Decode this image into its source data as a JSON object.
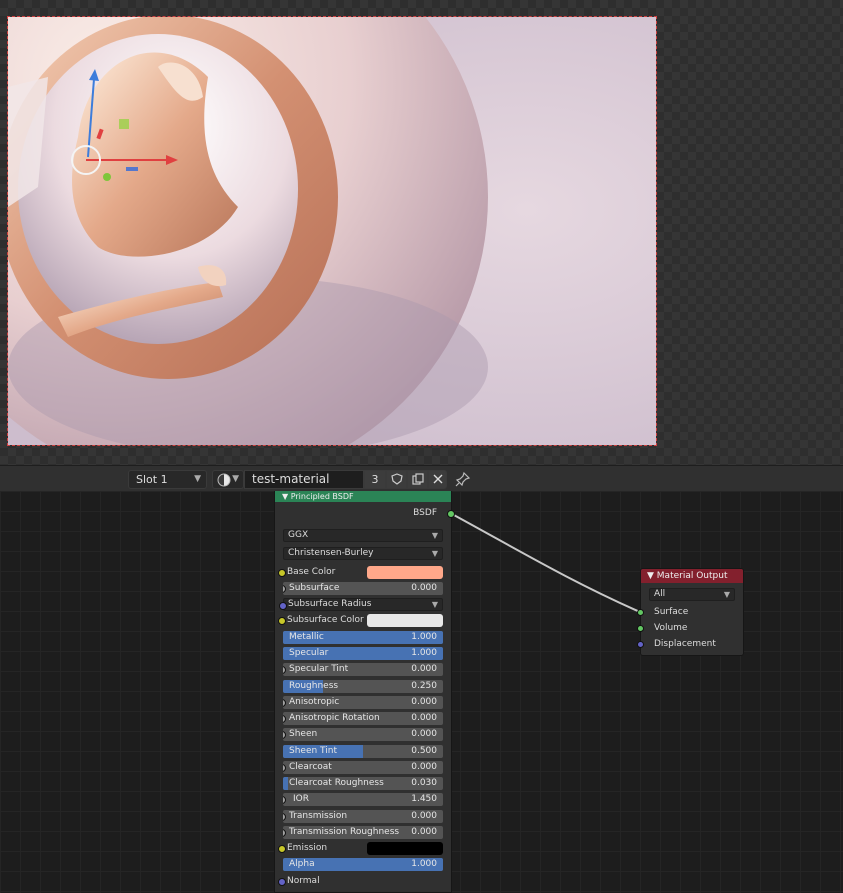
{
  "header": {
    "slot_label": "Slot 1",
    "material_name": "test-material",
    "user_count": "3"
  },
  "bsdf": {
    "title": "Principled BSDF",
    "output_label": "BSDF",
    "distribution": "GGX",
    "subsurface_method": "Christensen-Burley",
    "base_color_label": "Base Color",
    "base_color": "#ffa88a",
    "subsurface": {
      "label": "Subsurface",
      "value": "0.000",
      "fraction": 0
    },
    "subsurface_radius_label": "Subsurface Radius",
    "subsurface_color_label": "Subsurface Color",
    "subsurface_color": "#e8e8e8",
    "metallic": {
      "label": "Metallic",
      "value": "1.000",
      "fraction": 1.0
    },
    "specular": {
      "label": "Specular",
      "value": "1.000",
      "fraction": 1.0
    },
    "specular_tint": {
      "label": "Specular Tint",
      "value": "0.000",
      "fraction": 0
    },
    "roughness": {
      "label": "Roughness",
      "value": "0.250",
      "fraction": 0.25
    },
    "anisotropic": {
      "label": "Anisotropic",
      "value": "0.000",
      "fraction": 0
    },
    "anisotropic_rotation": {
      "label": "Anisotropic Rotation",
      "value": "0.000",
      "fraction": 0
    },
    "sheen": {
      "label": "Sheen",
      "value": "0.000",
      "fraction": 0
    },
    "sheen_tint": {
      "label": "Sheen Tint",
      "value": "0.500",
      "fraction": 0.5
    },
    "clearcoat": {
      "label": "Clearcoat",
      "value": "0.000",
      "fraction": 0
    },
    "clearcoat_roughness": {
      "label": "Clearcoat Roughness",
      "value": "0.030",
      "fraction": 0.03
    },
    "ior": {
      "label": "IOR",
      "value": "1.450"
    },
    "transmission": {
      "label": "Transmission",
      "value": "0.000",
      "fraction": 0
    },
    "transmission_roughness": {
      "label": "Transmission Roughness",
      "value": "0.000",
      "fraction": 0
    },
    "emission_label": "Emission",
    "emission_color": "#000000",
    "alpha": {
      "label": "Alpha",
      "value": "1.000",
      "fraction": 1.0
    },
    "normal_label": "Normal"
  },
  "material_output": {
    "title": "Material Output",
    "target": "All",
    "surface_label": "Surface",
    "volume_label": "Volume",
    "displacement_label": "Displacement"
  },
  "colors": {
    "bsdf_header": "#2b8456",
    "output_header": "#83202d",
    "slider_fill": "#4772b3",
    "socket_shader": "#63c763",
    "socket_color": "#c7c729",
    "socket_float": "#a1a1a1",
    "socket_vector": "#6363c7"
  }
}
